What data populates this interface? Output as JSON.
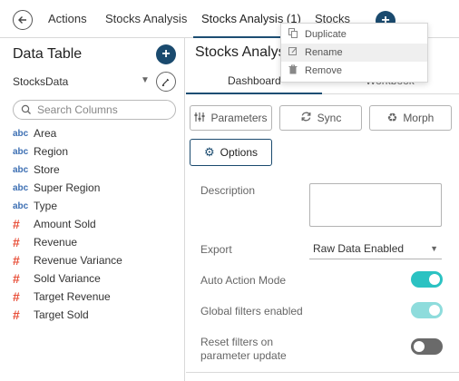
{
  "tabs": {
    "items": [
      {
        "label": "Actions"
      },
      {
        "label": "Stocks Analysis"
      },
      {
        "label": "Stocks Analysis (1)"
      },
      {
        "label": "Stocks"
      }
    ],
    "active_index": 2,
    "add_label": "+"
  },
  "context_menu": {
    "items": [
      {
        "label": "Duplicate",
        "icon": "copy-icon"
      },
      {
        "label": "Rename",
        "icon": "edit-icon"
      },
      {
        "label": "Remove",
        "icon": "trash-icon"
      }
    ],
    "hovered_index": 1
  },
  "left_panel": {
    "title": "Data Table",
    "add_label": "+",
    "source": "StocksData",
    "search_placeholder": "Search Columns",
    "columns": [
      {
        "type": "abc",
        "name": "Area"
      },
      {
        "type": "abc",
        "name": "Region"
      },
      {
        "type": "abc",
        "name": "Store"
      },
      {
        "type": "abc",
        "name": "Super Region"
      },
      {
        "type": "abc",
        "name": "Type"
      },
      {
        "type": "#",
        "name": "Amount Sold"
      },
      {
        "type": "#",
        "name": "Revenue"
      },
      {
        "type": "#",
        "name": "Revenue Variance"
      },
      {
        "type": "#",
        "name": "Sold Variance"
      },
      {
        "type": "#",
        "name": "Target Revenue"
      },
      {
        "type": "#",
        "name": "Target Sold"
      }
    ]
  },
  "right_panel": {
    "title": "Stocks Analysis",
    "tabs": [
      {
        "label": "Dashboard"
      },
      {
        "label": "Workbook"
      }
    ],
    "buttons": {
      "parameters": "Parameters",
      "sync": "Sync",
      "morph": "Morph",
      "options": "Options"
    },
    "form": {
      "description_label": "Description",
      "export_label": "Export",
      "export_value": "Raw Data Enabled",
      "auto_action_label": "Auto Action Mode",
      "auto_action_on": true,
      "global_filters_label": "Global filters enabled",
      "global_filters_on": true,
      "reset_filters_label_1": "Reset filters on",
      "reset_filters_label_2": "parameter update",
      "reset_filters_on": false
    }
  },
  "colors": {
    "accent": "#1a4a6e",
    "toggle_on": "#2bc2c2",
    "toggle_off": "#6a6a6a",
    "string_type": "#3d6fb3",
    "number_type": "#e8503a"
  }
}
